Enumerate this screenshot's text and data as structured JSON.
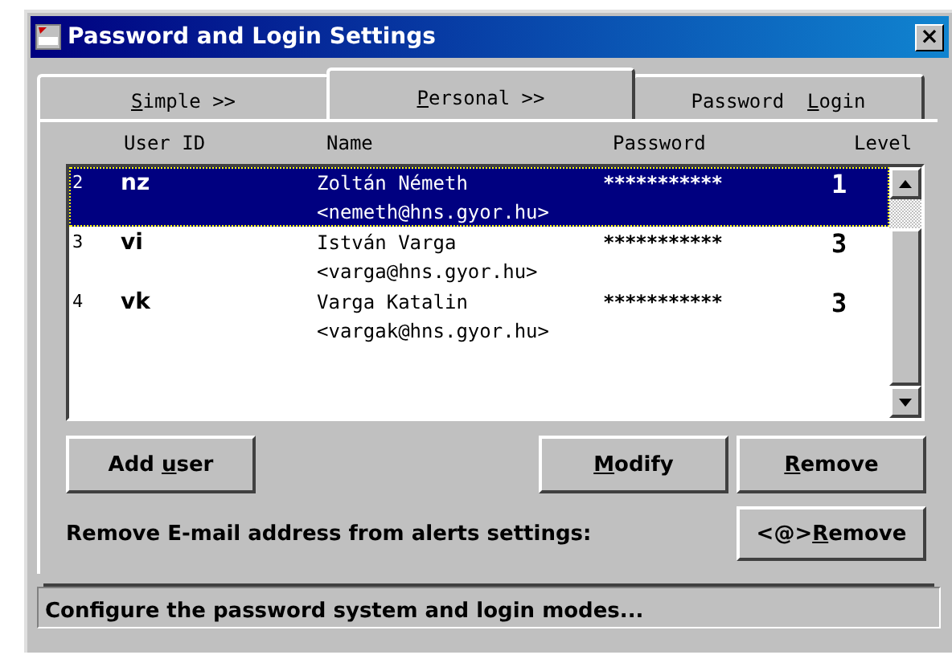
{
  "window": {
    "title": "Password and Login Settings",
    "close": "×"
  },
  "tabs": [
    {
      "label": [
        {
          "text": "S",
          "underlined": true
        },
        {
          "text": "imple >>",
          "underlined": false
        }
      ],
      "selected": false
    },
    {
      "label": [
        {
          "text": "P",
          "underlined": true
        },
        {
          "text": "ersonal >>",
          "underlined": false
        }
      ],
      "selected": true
    },
    {
      "label": [
        {
          "text": "Password  ",
          "underlined": false
        },
        {
          "text": "L",
          "underlined": true
        },
        {
          "text": "ogin",
          "underlined": false
        }
      ],
      "selected": false
    }
  ],
  "table": {
    "columns": [
      "User ID",
      "Name",
      "Password",
      "Level"
    ],
    "rows": [
      {
        "number": "2",
        "user_id": "nz",
        "name": "Zoltán Németh",
        "email": "<nemeth@hns.gyor.hu>",
        "password": "***********",
        "level": "1",
        "selected": true
      },
      {
        "number": "3",
        "user_id": "vi",
        "name": "István Varga",
        "email": "<varga@hns.gyor.hu>",
        "password": "***********",
        "level": "3",
        "selected": false
      },
      {
        "number": "4",
        "user_id": "vk",
        "name": "Varga Katalin",
        "email": "<vargak@hns.gyor.hu>",
        "password": "***********",
        "level": "3",
        "selected": false
      }
    ]
  },
  "buttons": [
    {
      "label": [
        {
          "text": "Add ",
          "underlined": false
        },
        {
          "text": "u",
          "underlined": true
        },
        {
          "text": "ser",
          "underlined": false
        }
      ]
    },
    {
      "label": [
        {
          "text": "M",
          "underlined": true
        },
        {
          "text": "odify",
          "underlined": false
        }
      ]
    },
    {
      "label": [
        {
          "text": "R",
          "underlined": true
        },
        {
          "text": "emove",
          "underlined": false
        }
      ]
    }
  ],
  "email_remove": {
    "label": "Remove E-mail address from alerts settings:",
    "button": {
      "label": [
        {
          "text": "<@>",
          "underlined": false
        },
        {
          "text": "R",
          "underlined": true
        },
        {
          "text": "emove",
          "underlined": false
        }
      ]
    }
  },
  "status_bar": "Configure the password system and login modes..."
}
